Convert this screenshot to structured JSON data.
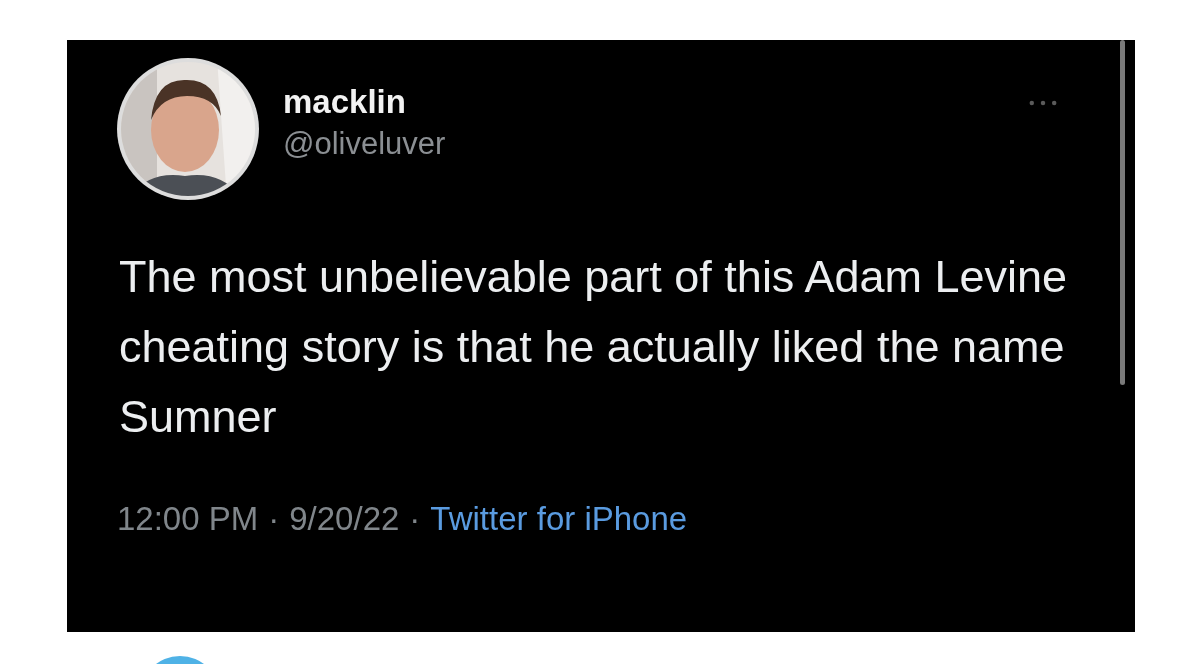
{
  "tweet": {
    "author": {
      "name": "macklin",
      "handle": "@oliveluver"
    },
    "text": "The most unbelievable part of this Adam Levine cheating story is that he actually liked the name Sumner",
    "footer": [
      {
        "kind": "meta",
        "text": "12:00 PM"
      },
      {
        "kind": "separator",
        "text": "·"
      },
      {
        "kind": "meta",
        "text": "9/20/22"
      },
      {
        "kind": "separator",
        "text": "·"
      },
      {
        "kind": "link",
        "text": "Twitter for iPhone"
      }
    ]
  }
}
